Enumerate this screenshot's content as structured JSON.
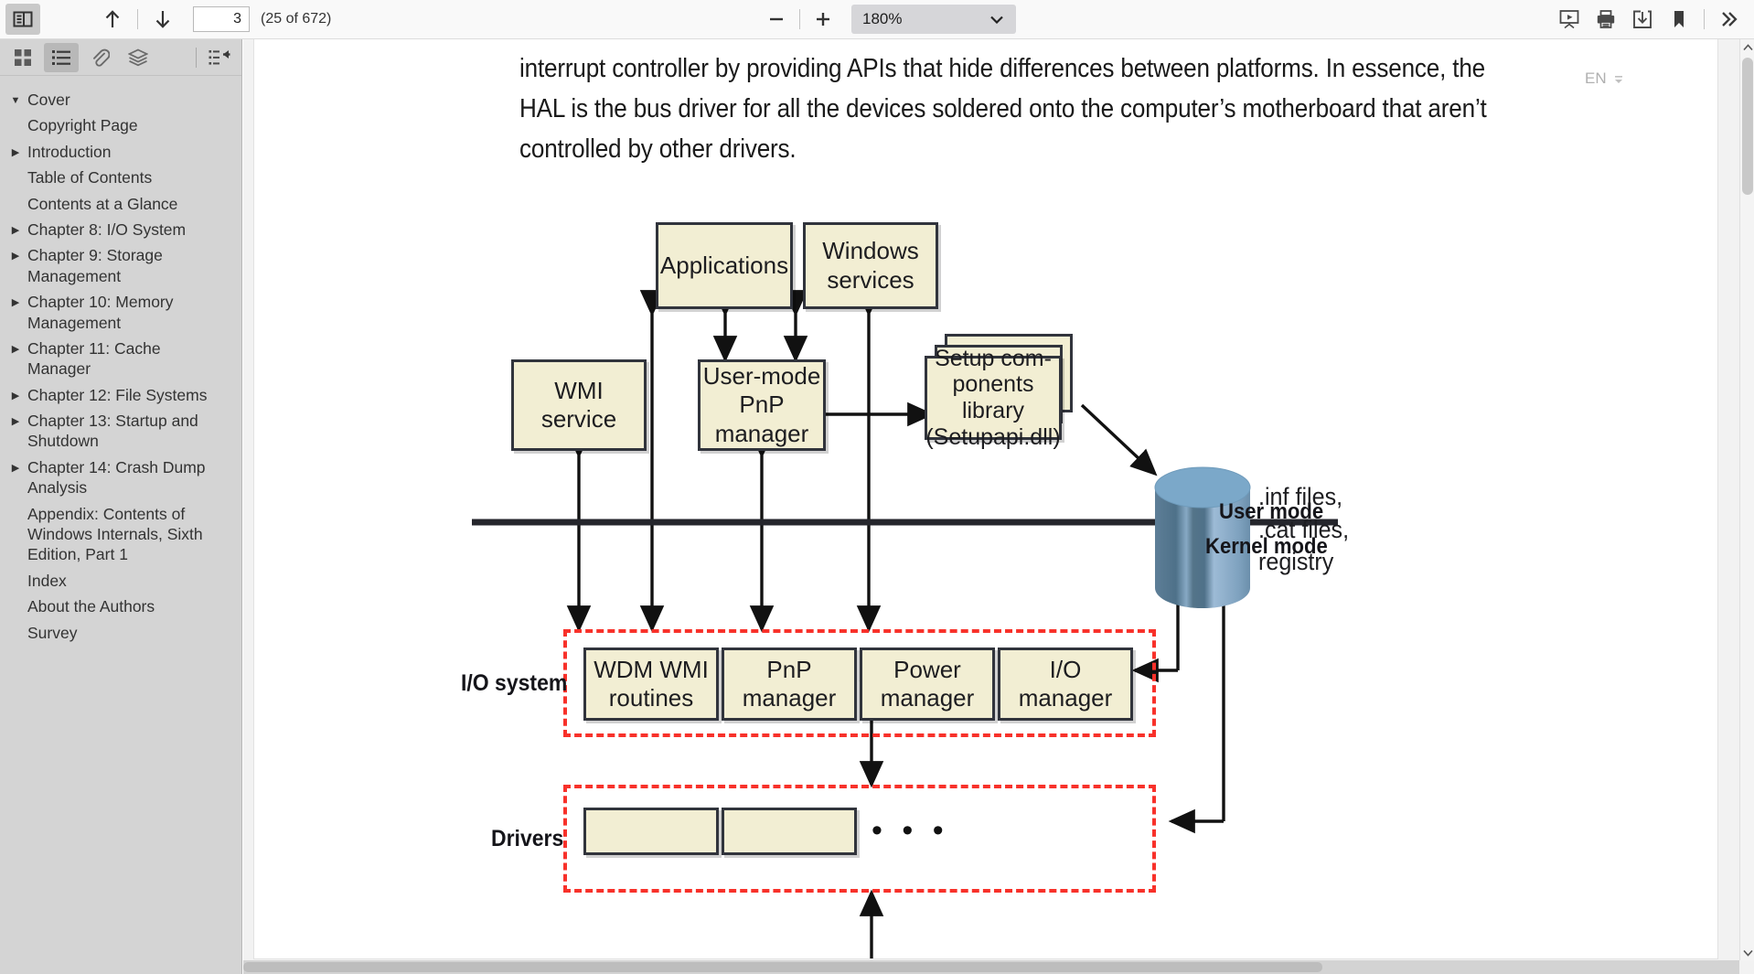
{
  "toolbar": {
    "sidebar_toggle": "sidebar-toggle",
    "prev_page": "↑",
    "next_page": "↓",
    "page_number_value": "3",
    "page_count_label": "(25 of 672)",
    "zoom_out": "−",
    "zoom_in": "+",
    "zoom_value": "180%",
    "zoom_chevron": "⌄",
    "icons": {
      "presentation": "presentation-icon",
      "print": "print-icon",
      "save": "save-icon",
      "bookmark": "bookmark-icon",
      "more": "»"
    }
  },
  "ime": {
    "language": "EN"
  },
  "sidebar": {
    "tabs": [
      {
        "name": "thumbnails",
        "active": false
      },
      {
        "name": "outline",
        "active": true
      },
      {
        "name": "attachments",
        "active": false
      },
      {
        "name": "layers",
        "active": false
      },
      {
        "name": "collapse-outline",
        "active": false
      }
    ],
    "outline": [
      {
        "label": "Cover",
        "twisty": "▼",
        "child": false
      },
      {
        "label": "Copyright Page",
        "twisty": "",
        "child": true
      },
      {
        "label": "Introduction",
        "twisty": "▶",
        "child": false
      },
      {
        "label": "Table of Contents",
        "twisty": "",
        "child": false
      },
      {
        "label": "Contents at a Glance",
        "twisty": "",
        "child": false
      },
      {
        "label": "Chapter 8: I/O System",
        "twisty": "▶",
        "child": false
      },
      {
        "label": "Chapter 9: Storage Management",
        "twisty": "▶",
        "child": false
      },
      {
        "label": "Chapter 10: Memory Management",
        "twisty": "▶",
        "child": false
      },
      {
        "label": "Chapter 11: Cache Manager",
        "twisty": "▶",
        "child": false
      },
      {
        "label": "Chapter 12: File Systems",
        "twisty": "▶",
        "child": false
      },
      {
        "label": "Chapter 13: Startup and Shutdown",
        "twisty": "▶",
        "child": false
      },
      {
        "label": "Chapter 14: Crash Dump Analysis",
        "twisty": "▶",
        "child": false
      },
      {
        "label": "Appendix: Contents of Windows Internals, Sixth Edition, Part 1",
        "twisty": "",
        "child": false
      },
      {
        "label": "Index",
        "twisty": "",
        "child": false
      },
      {
        "label": "About the Authors",
        "twisty": "",
        "child": false
      },
      {
        "label": "Survey",
        "twisty": "",
        "child": false
      }
    ]
  },
  "document": {
    "body_text": "interrupt controller by providing APIs that hide differences between platforms. In essence, the HAL is the bus driver for all the devices soldered onto the computer’s motherboard that aren’t controlled by other drivers."
  },
  "diagram": {
    "boxes": {
      "applications": "Applications",
      "windows_services": "Windows\nservices",
      "wmi_service": "WMI\nservice",
      "usermode_pnp": "User-mode\nPnP manager",
      "setup_components": "Setup com-\nponents library\n(Setupapi.dll)",
      "wdm_wmi": "WDM WMI\nroutines",
      "pnp_manager": "PnP\nmanager",
      "power_manager": "Power\nmanager",
      "io_manager": "I/O\nmanager",
      "driver_1": "",
      "driver_2": ""
    },
    "labels": {
      "user_mode": "User mode",
      "kernel_mode": "Kernel mode",
      "io_system": "I/O system",
      "drivers": "Drivers",
      "storage": ".inf files,\n.cat files,\nregistry",
      "ellipsis": "• • •"
    },
    "colors": {
      "box_fill": "#f2eed3",
      "box_border": "#31343c",
      "dashed_group": "#f8312a",
      "cylinder_top": "#7ba3c4",
      "cylinder_body": "#5e7f99"
    }
  }
}
